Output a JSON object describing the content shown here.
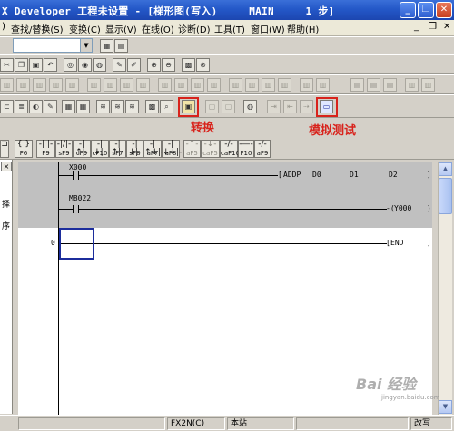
{
  "window": {
    "title": "X Developer 工程未设置 - [梯形图(写入)     MAIN     1 步]"
  },
  "menubar": {
    "items": [
      "查找/替换(S)",
      "变换(C)",
      "显示(V)",
      "在线(O)",
      "诊断(D)",
      "工具(T)",
      "窗口(W)",
      "帮助(H)"
    ]
  },
  "toolbar": {
    "combo_value": ""
  },
  "annotations": {
    "convert": "转换",
    "simulate": "模拟测试"
  },
  "fkeys": [
    {
      "sym": "{ }",
      "key": "F6"
    },
    {
      "sym": "-| |-",
      "key": "F9"
    },
    {
      "sym": "-|/|-",
      "key": "sF9"
    },
    {
      "sym": "-|↑|-",
      "key": "cF9"
    },
    {
      "sym": "-|↓|-",
      "key": "cF10"
    },
    {
      "sym": "-|↑|-",
      "key": "sF7"
    },
    {
      "sym": "-|↓|-",
      "key": "sF8"
    },
    {
      "sym": "-|↑↓|-",
      "key": "aF7"
    },
    {
      "sym": "-|↓↓|-",
      "key": "aF8"
    },
    {
      "sym": "-↑-",
      "key": "aF5"
    },
    {
      "sym": "-↓-",
      "key": "caF5"
    },
    {
      "sym": "-/-",
      "key": "caF10"
    },
    {
      "sym": "-—-",
      "key": "F10"
    },
    {
      "sym": "-/-",
      "key": "aF9"
    }
  ],
  "left_panel": {
    "cut_chars": [
      "择",
      "序"
    ]
  },
  "ladder": {
    "rung1": {
      "contact": "X000",
      "instruction": "ADDP",
      "op1": "D0",
      "op2": "D1",
      "op3": "D2"
    },
    "rung2": {
      "contact": "M8022",
      "coil": "Y000"
    },
    "rung3": {
      "step": "0",
      "instruction": "END"
    }
  },
  "status": {
    "plc": "FX2N(C)",
    "station": "本站",
    "mode": "改写"
  },
  "watermark": {
    "brand": "Bai 经验",
    "url": "jingyan.baidu.com"
  },
  "colors": {
    "title_bar": "#2458c8",
    "highlight_red": "#d8231c",
    "cursor": "#1c2d9c",
    "ladder_gray": "#c0c0c0"
  }
}
